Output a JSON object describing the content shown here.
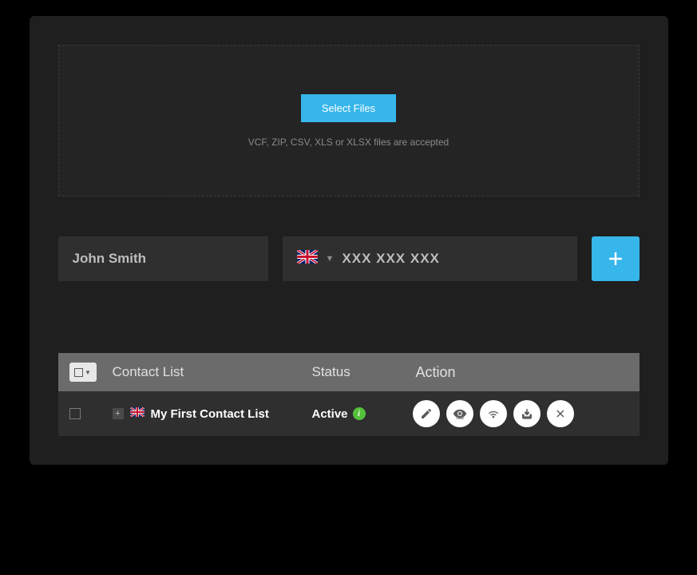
{
  "upload": {
    "button_label": "Select Files",
    "hint": "VCF, ZIP, CSV, XLS or XLSX files are accepted"
  },
  "form": {
    "name_value": "John Smith",
    "phone_placeholder": "XXX XXX XXX",
    "country": "UK"
  },
  "table": {
    "headers": {
      "list": "Contact List",
      "status": "Status",
      "action": "Action"
    },
    "rows": [
      {
        "name": "My First Contact List",
        "status": "Active",
        "country": "UK"
      }
    ]
  }
}
